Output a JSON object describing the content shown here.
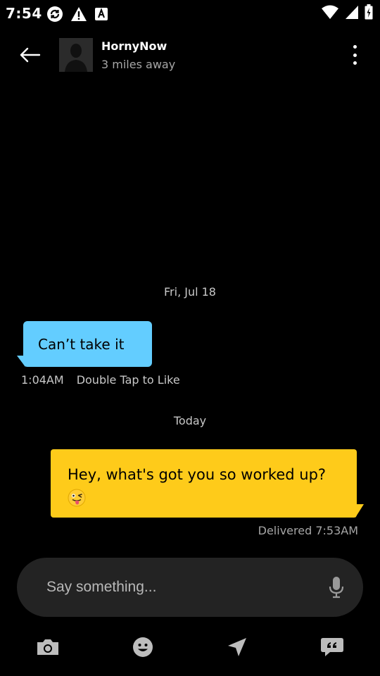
{
  "status_bar": {
    "time": "7:54"
  },
  "header": {
    "contact_name": "HornyNow",
    "distance": "3 miles away"
  },
  "chat": {
    "date_separator_1": "Fri, Jul 18",
    "incoming": {
      "text": "Can’t take it",
      "time": "1:04AM",
      "hint": "Double Tap to Like"
    },
    "date_separator_2": "Today",
    "outgoing": {
      "text": "Hey, what's got you so worked up?",
      "emoji": "winking-tongue-face",
      "status": "Delivered 7:53AM"
    }
  },
  "composer": {
    "placeholder": "Say something..."
  },
  "toolbar": {
    "icons": [
      "camera-icon",
      "emoji-icon",
      "location-icon",
      "quick-phrases-icon"
    ]
  },
  "colors": {
    "background": "#000000",
    "incoming_bubble": "#63cdff",
    "outgoing_bubble": "#fecb1a",
    "composer": "#232323"
  }
}
